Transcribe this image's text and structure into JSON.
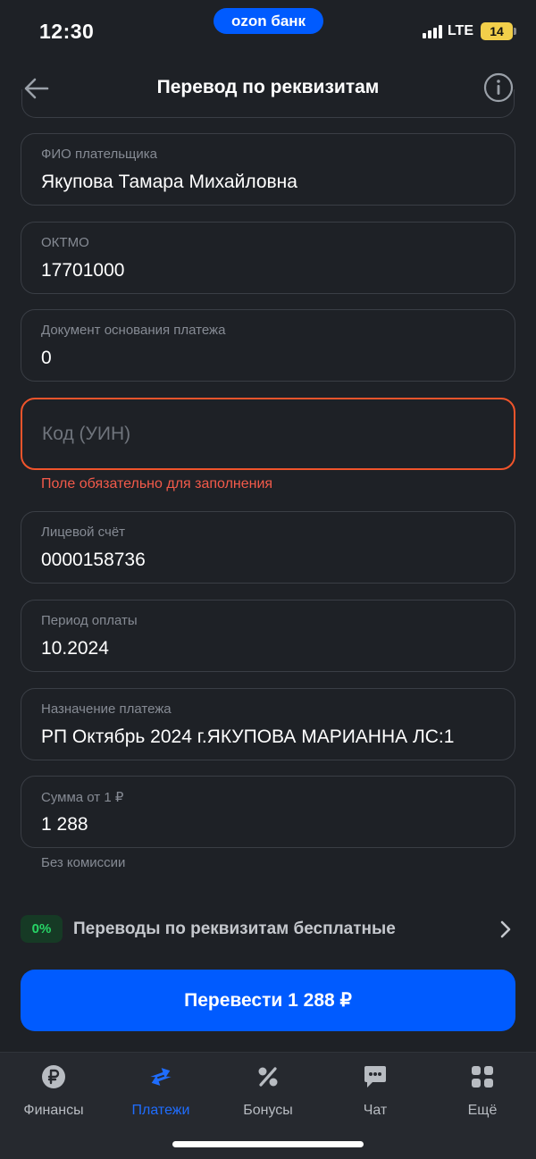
{
  "status_bar": {
    "time": "12:30",
    "brand": "ozon банк",
    "network": "LTE",
    "battery": "14"
  },
  "header": {
    "title": "Перевод по реквизитам"
  },
  "fields": [
    {
      "label": "ФИО плательщика",
      "value": "Якупова Тамара Михайловна"
    },
    {
      "label": "ОКТМО",
      "value": "17701000"
    },
    {
      "label": "Документ основания платежа",
      "value": "0"
    },
    {
      "placeholder": "Код (УИН)",
      "error": "Поле обязательно для заполнения"
    },
    {
      "label": "Лицевой счёт",
      "value": "0000158736"
    },
    {
      "label": "Период оплаты",
      "value": "10.2024"
    },
    {
      "label": "Назначение платежа",
      "value": "РП Октябрь 2024 г.ЯКУПОВА МАРИАННА ЛС:1"
    },
    {
      "label": "Сумма от 1 ₽",
      "value": "1 288",
      "hint": "Без комиссии"
    }
  ],
  "promo": {
    "badge": "0%",
    "text": "Переводы по реквизитам бесплатные"
  },
  "submit_button": "Перевести 1 288 ₽",
  "tabs": [
    {
      "label": "Финансы",
      "icon": "ruble-coin-icon",
      "active": false
    },
    {
      "label": "Платежи",
      "icon": "transfer-arrows-icon",
      "active": true
    },
    {
      "label": "Бонусы",
      "icon": "percent-icon",
      "active": false
    },
    {
      "label": "Чат",
      "icon": "chat-bubble-icon",
      "active": false
    },
    {
      "label": "Ещё",
      "icon": "grid-icon",
      "active": false
    }
  ],
  "colors": {
    "accent": "#005bff",
    "error": "#f0542b",
    "background": "#1e2126"
  }
}
